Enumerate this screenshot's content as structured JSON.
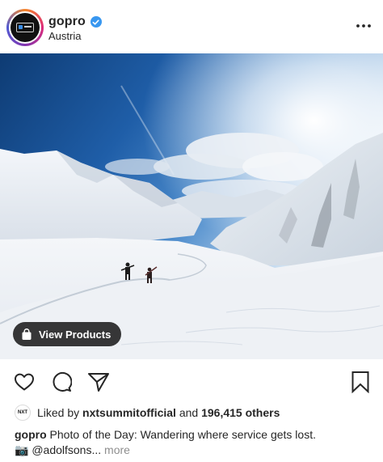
{
  "post": {
    "username": "gopro",
    "location": "Austria",
    "verified": true,
    "avatar_logo": "GoPro"
  },
  "photo": {
    "description": "",
    "view_products_label": "View Products"
  },
  "actions": {
    "icons": [
      "heart-icon",
      "comment-icon",
      "share-icon",
      "bookmark-icon"
    ]
  },
  "likes": {
    "prefix": "Liked by",
    "liked_by_user": "nxtsummitofficial",
    "conjunction": "and",
    "others": "196,415 others",
    "mini_avatar_text": "NXT"
  },
  "caption": {
    "username": "gopro",
    "text": "Photo of the Day: Wandering where service gets lost.",
    "camera_emoji": "📷",
    "mention": "@adolfsons...",
    "more": "more"
  },
  "colors": {
    "text": "#262626",
    "muted": "#8e8e8e",
    "verified": "#3897f0"
  }
}
